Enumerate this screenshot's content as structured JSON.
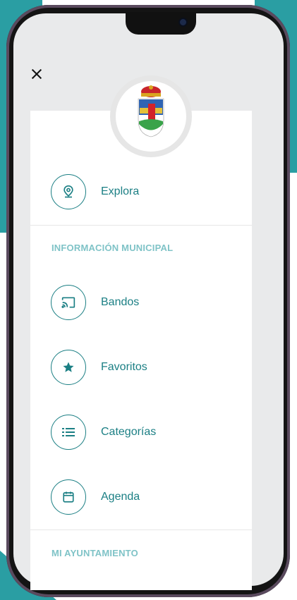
{
  "menu": {
    "close_icon": "close-icon",
    "explore": {
      "label": "Explora",
      "icon": "map-pin-icon"
    },
    "sections": [
      {
        "title": "INFORMACIÓN MUNICIPAL",
        "items": [
          {
            "label": "Bandos",
            "icon": "cast-icon"
          },
          {
            "label": "Favoritos",
            "icon": "star-icon"
          },
          {
            "label": "Categorías",
            "icon": "list-icon"
          },
          {
            "label": "Agenda",
            "icon": "calendar-icon"
          }
        ]
      },
      {
        "title": "MI AYUNTAMIENTO"
      }
    ]
  },
  "colors": {
    "accent": "#1b7f84",
    "section": "#7fc3c7",
    "background_teal": "#2a9ea3"
  }
}
